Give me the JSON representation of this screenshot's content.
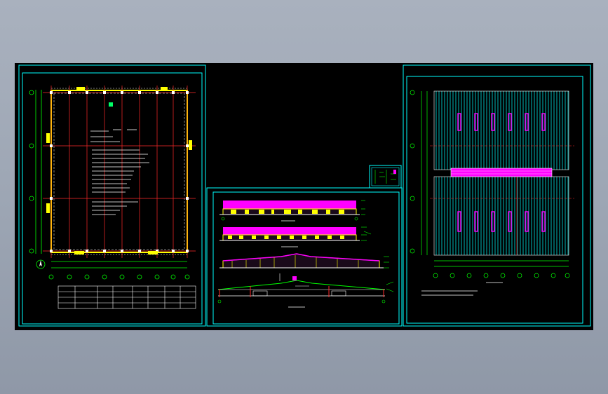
{
  "window": {
    "title": "",
    "colors": {
      "background_top": "#a9b1be",
      "background_bottom": "#8f98a7",
      "canvas": "#000000",
      "frame": "#00ffff",
      "column_grid": "#ff2a2a",
      "wall": "#ffff00",
      "roof_fill": "#ff00ff",
      "roof_sheeting": "#00e5e5",
      "dimension": "#00ff00",
      "text": "#ffffff"
    }
  },
  "drawing_sheets": [
    {
      "id": "floor-plan",
      "label": ""
    },
    {
      "id": "elevations-and-sections",
      "label": ""
    },
    {
      "id": "roof-plan",
      "label": ""
    },
    {
      "id": "detail-legend",
      "label": ""
    }
  ],
  "icons": {
    "north_arrow": "north-arrow-icon",
    "axis_bubble": "axis-bubble-icon"
  }
}
